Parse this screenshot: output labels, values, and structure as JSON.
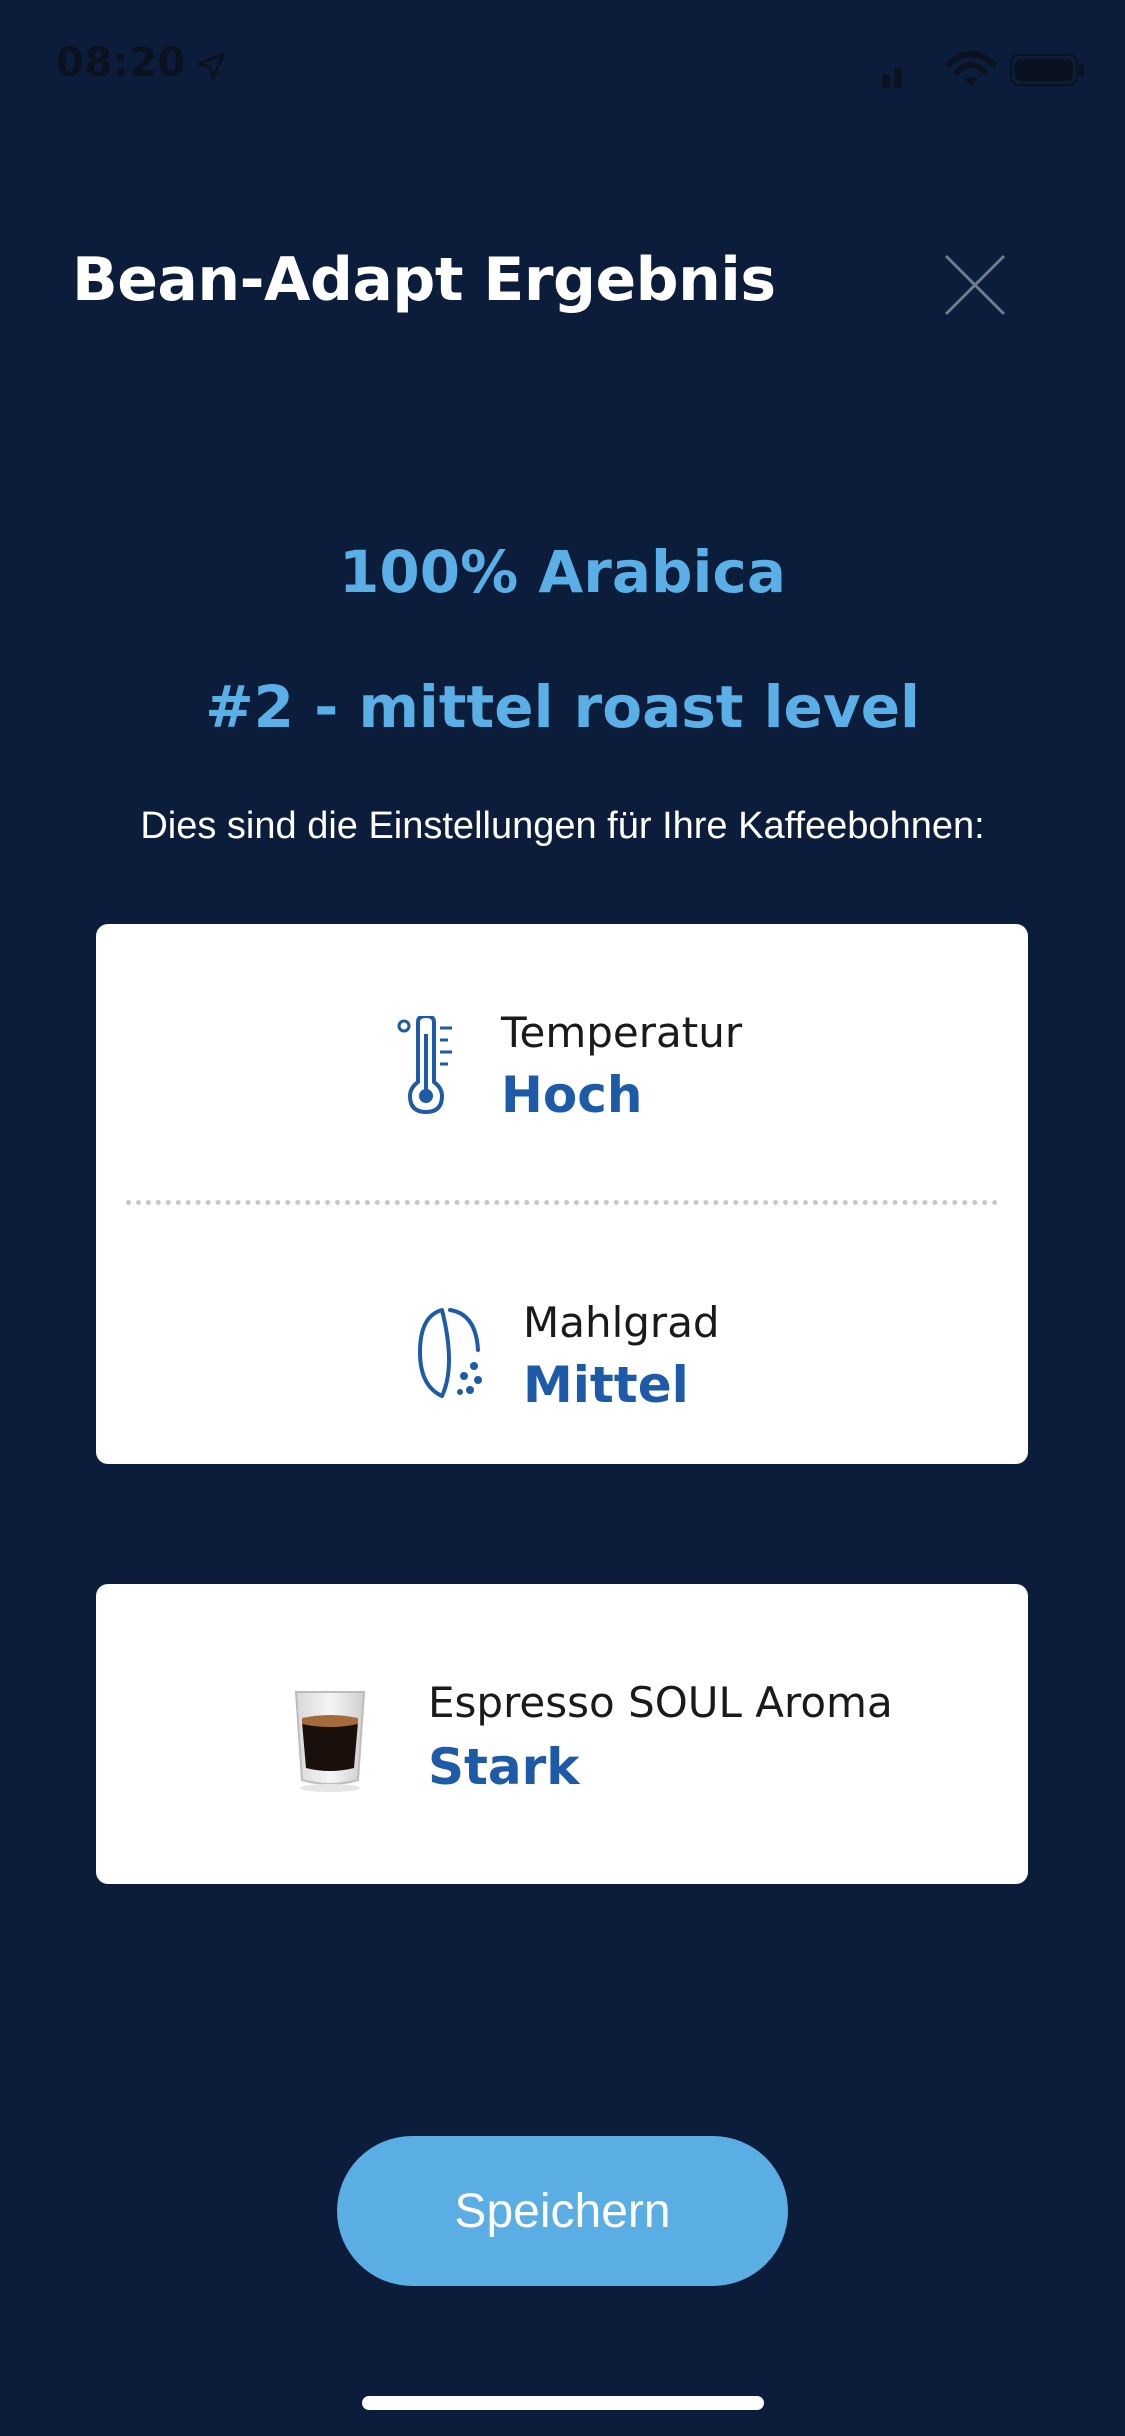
{
  "status_bar": {
    "time": "08:20",
    "icons": [
      "location-arrow-icon",
      "cellular-signal-icon",
      "wifi-icon",
      "battery-icon"
    ]
  },
  "header": {
    "title": "Bean-Adapt Ergebnis",
    "close_icon": "close-icon"
  },
  "result": {
    "bean_type": "100% Arabica",
    "roast_level": "#2 - mittel roast level",
    "intro": "Dies sind die Einstellungen für Ihre Kaffeebohnen:"
  },
  "settings": [
    {
      "icon": "thermometer-icon",
      "label": "Temperatur",
      "value": "Hoch"
    },
    {
      "icon": "grind-icon",
      "label": "Mahlgrad",
      "value": "Mittel"
    }
  ],
  "aroma": {
    "icon": "espresso-cup-icon",
    "label": "Espresso SOUL Aroma",
    "value": "Stark"
  },
  "actions": {
    "save_label": "Speichern"
  },
  "colors": {
    "background": "#0b1d3a",
    "accent": "#5aafe6",
    "value_text": "#1d5aa8",
    "button": "#5aaee3"
  }
}
